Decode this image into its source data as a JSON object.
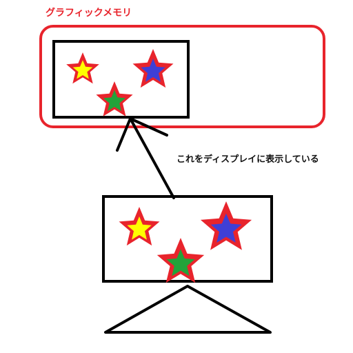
{
  "graphic_memory_label": "グラフィックメモリ",
  "caption": "これをディスプレイに表示している",
  "colors": {
    "memory_border": "#e8242c",
    "frame": "#000000",
    "star_outline": "#e8242c",
    "star_yellow": "#ffff00",
    "star_blue": "#3f3fd6",
    "star_green": "#22a33a"
  },
  "memory_stars": [
    {
      "fill": "star_yellow",
      "name": "memory-star-yellow"
    },
    {
      "fill": "star_blue",
      "name": "memory-star-blue"
    },
    {
      "fill": "star_green",
      "name": "memory-star-green"
    }
  ],
  "display_stars": [
    {
      "fill": "star_yellow",
      "name": "display-star-yellow"
    },
    {
      "fill": "star_blue",
      "name": "display-star-blue"
    },
    {
      "fill": "star_green",
      "name": "display-star-green"
    }
  ]
}
